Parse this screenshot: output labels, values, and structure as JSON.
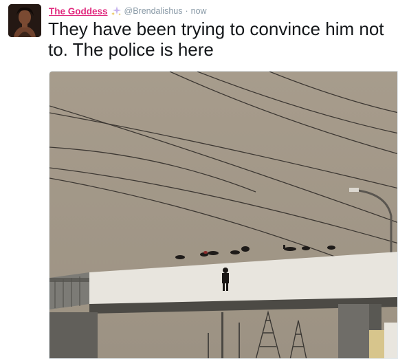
{
  "tweet": {
    "display_name": "The Goddess",
    "name_emoji": "sparkles-icon",
    "handle": "@Brendalishus",
    "separator": "·",
    "timestamp": "now",
    "text": "They have been trying to convince him not\nto. The police is here",
    "media": {
      "type": "photo",
      "subject": "crowd-on-pedestrian-bridge"
    }
  },
  "colors": {
    "name": "#e0287d",
    "meta": "#8899a6",
    "text": "#14171a",
    "sky": "#a69a8a"
  }
}
